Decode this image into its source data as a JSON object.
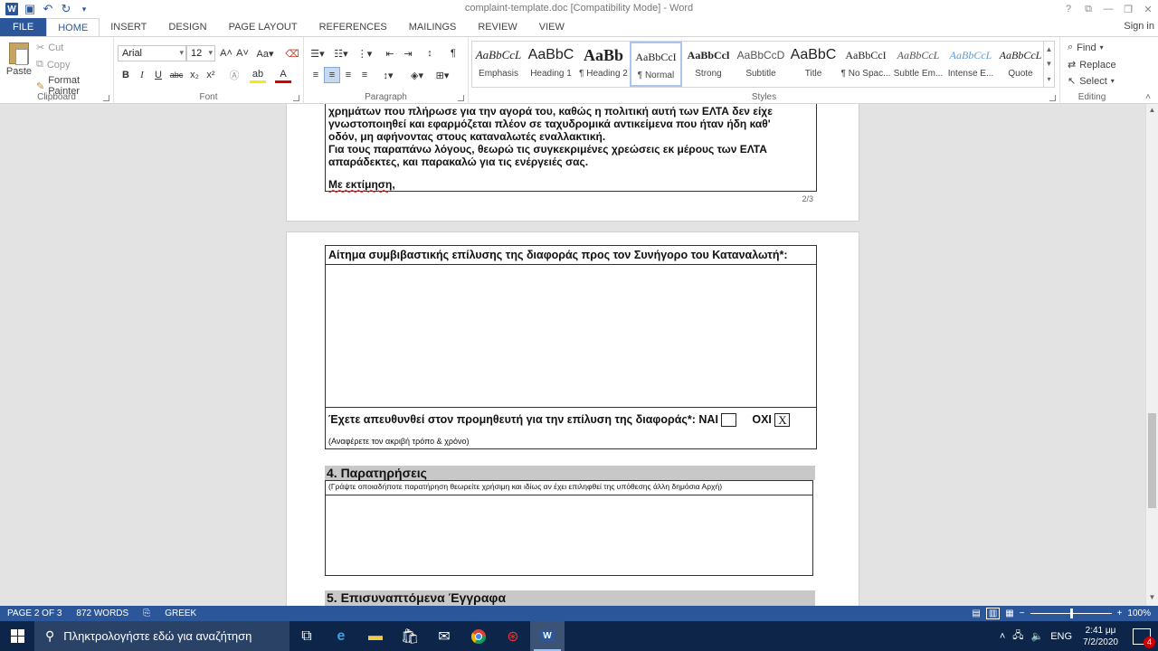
{
  "window": {
    "title": "complaint-template.doc [Compatibility Mode] - Word",
    "controls": [
      "?",
      "⧉",
      "—",
      "❐",
      "✕"
    ]
  },
  "quick_access": {
    "icons": [
      "word-logo",
      "save-icon",
      "undo-icon",
      "redo-icon",
      "customize-icon"
    ]
  },
  "tabs": [
    "FILE",
    "HOME",
    "INSERT",
    "DESIGN",
    "PAGE LAYOUT",
    "REFERENCES",
    "MAILINGS",
    "REVIEW",
    "VIEW"
  ],
  "active_tab": "HOME",
  "sign_in": "Sign in",
  "ribbon": {
    "clipboard": {
      "label": "Clipboard",
      "paste": "Paste",
      "cut": "Cut",
      "copy": "Copy",
      "format_painter": "Format Painter"
    },
    "font": {
      "label": "Font",
      "font_name": "Arial",
      "font_size": "12"
    },
    "paragraph": {
      "label": "Paragraph"
    },
    "styles": {
      "label": "Styles",
      "items": [
        {
          "preview": "AaBbCcL",
          "name": "Emphasis"
        },
        {
          "preview": "AaBbC",
          "name": "Heading 1"
        },
        {
          "preview": "AaBb",
          "name": "¶ Heading 2"
        },
        {
          "preview": "AaBbCcI",
          "name": "¶ Normal"
        },
        {
          "preview": "AaBbCcl",
          "name": "Strong"
        },
        {
          "preview": "AaBbCcD",
          "name": "Subtitle"
        },
        {
          "preview": "AaBbC",
          "name": "Title"
        },
        {
          "preview": "AaBbCcI",
          "name": "¶ No Spac..."
        },
        {
          "preview": "AaBbCcL",
          "name": "Subtle Em..."
        },
        {
          "preview": "AaBbCcL",
          "name": "Intense E..."
        },
        {
          "preview": "AaBbCcL",
          "name": "Quote"
        }
      ],
      "selected": "¶ Normal"
    },
    "editing": {
      "label": "Editing",
      "find": "Find",
      "replace": "Replace",
      "select": "Select"
    }
  },
  "document": {
    "page1": {
      "lines": [
        "χρημάτων που πλήρωσε για την αγορά του, καθώς η πολιτική αυτή των ΕΛΤΑ δεν είχε",
        "γνωστοποιηθεί και εφαρμόζεται πλέον σε ταχυδρομικά αντικείμενα που ήταν ήδη καθ'",
        "οδόν, μη αφήνοντας στους καταναλωτές εναλλακτική.",
        "Για τους παραπάνω λόγους, θεωρώ τις συγκεκριμένες χρεώσεις εκ μέρους των ΕΛΤΑ",
        "απαράδεκτες, και παρακαλώ για τις ενέργειές σας."
      ],
      "closing": "Με εκτίμηση,",
      "page_number": "2/3"
    },
    "page2": {
      "request_heading": "Αίτημα συμβιβαστικής επίλυσης της διαφοράς προς τον Συνήγορο του Καταναλωτή*:",
      "supplier_question": "Έχετε απευθυνθεί στον προμηθευτή για την επίλυση της διαφοράς*: ΝΑΙ",
      "yes_checked": "",
      "no_label": "ΟΧΙ",
      "no_checked": "X",
      "supplier_hint": "(Αναφέρετε τον ακριβή τρόπο & χρόνο)",
      "section4_title": "4. Παρατηρήσεις",
      "section4_hint": "(Γράψτε οποιαδήποτε παρατήρηση θεωρείτε χρήσιμη και ιδίως αν έχει επιληφθεί της υπόθεσης άλλη δημόσια Αρχή)",
      "section5_title": "5. Επισυναπτόμενα Έγγραφα"
    }
  },
  "status_bar": {
    "page": "PAGE 2 OF 3",
    "words": "872 WORDS",
    "language": "GREEK",
    "zoom": "100%",
    "zoom_fraction": 0.5
  },
  "taskbar": {
    "search_placeholder": "Πληκτρολογήστε εδώ για αναζήτηση",
    "apps": [
      "task-view-icon",
      "edge-icon",
      "file-explorer-icon",
      "store-icon",
      "mail-icon",
      "chrome-icon",
      "app-icon",
      "word-icon"
    ],
    "tray_lang": "ENG",
    "time": "2:41 μμ",
    "date": "7/2/2020",
    "notifications": "4"
  }
}
